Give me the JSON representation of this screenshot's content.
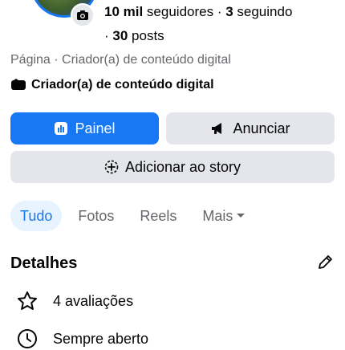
{
  "profile": {
    "followers_count": "10 mil",
    "followers_label": " seguidores · ",
    "following_count": "3",
    "following_label": " seguindo",
    "posts_sep": "· ",
    "posts_count": "30",
    "posts_label": " posts",
    "category_line": "Página · Criador(a) de conteúdo digital",
    "creator_badge": "Criador(a) de conteúdo digital"
  },
  "actions": {
    "panel": "Painel",
    "advertise": "Anunciar",
    "add_story": "Adicionar ao story"
  },
  "tabs": [
    {
      "label": "Tudo",
      "active": true
    },
    {
      "label": "Fotos"
    },
    {
      "label": "Reels"
    },
    {
      "label": "Mais"
    }
  ],
  "details": {
    "title": "Detalhes",
    "items": [
      {
        "icon": "star-icon",
        "text": "4 avaliações"
      },
      {
        "icon": "clock-icon",
        "text": "Sempre aberto"
      }
    ]
  },
  "colors": {
    "primary": "#1877f2",
    "secondary_bg": "#e4e6eb",
    "muted_text": "#65676b",
    "active_tab_bg": "#e7f3ff"
  }
}
